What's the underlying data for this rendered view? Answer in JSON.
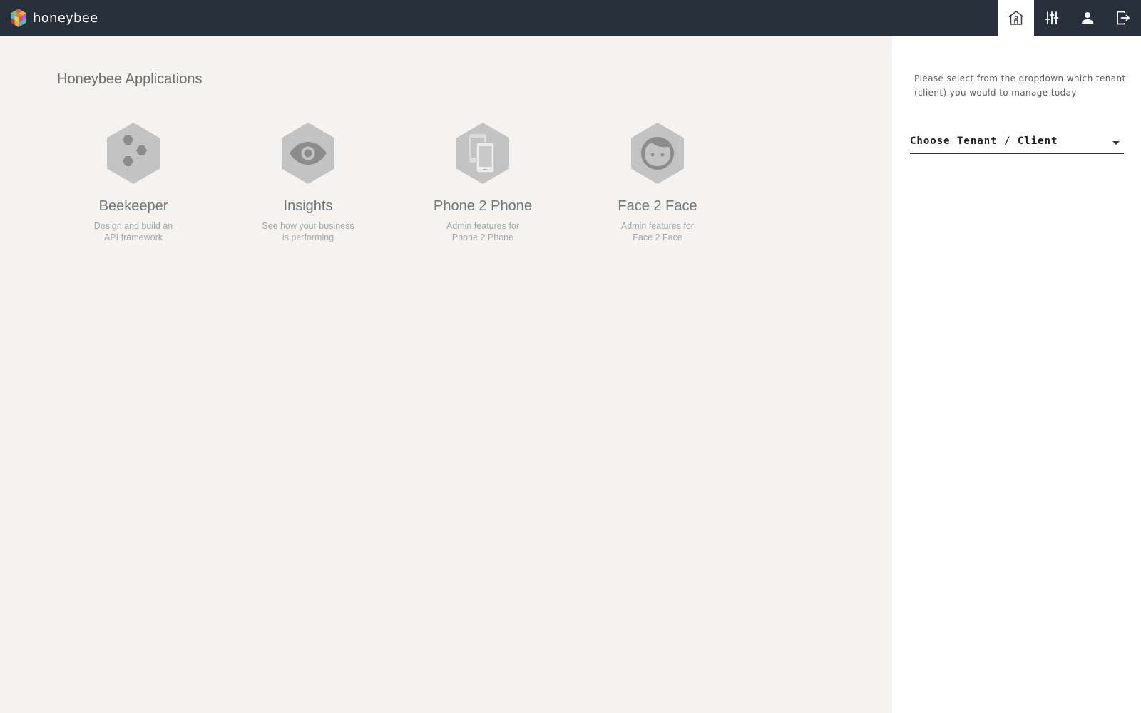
{
  "topbar": {
    "brand_name": "honeybee",
    "nav": [
      {
        "icon": "home-icon"
      },
      {
        "icon": "sliders-icon"
      },
      {
        "icon": "user-icon"
      },
      {
        "icon": "logout-icon"
      }
    ]
  },
  "main": {
    "title": "Honeybee Applications",
    "apps": [
      {
        "title": "Beekeeper",
        "desc": "Design and build an\nAPI framework",
        "icon": "honeycomb-icon"
      },
      {
        "title": "Insights",
        "desc": "See how your business\nis performing",
        "icon": "eye-icon"
      },
      {
        "title": "Phone 2 Phone",
        "desc": "Admin features for\nPhone 2 Phone",
        "icon": "phones-icon"
      },
      {
        "title": "Face 2 Face",
        "desc": "Admin features for\nFace 2 Face",
        "icon": "face-icon"
      }
    ]
  },
  "side": {
    "help_text": "Please select from the dropdown which tenant (client) you would to manage today",
    "tenant_select": {
      "label": "Choose Tenant / Client"
    }
  },
  "colors": {
    "topbar_bg": "#28303c",
    "main_bg": "#f4f3f1",
    "hex_fill": "#c3c3c3",
    "hex_glyph": "#8c8c8c"
  }
}
